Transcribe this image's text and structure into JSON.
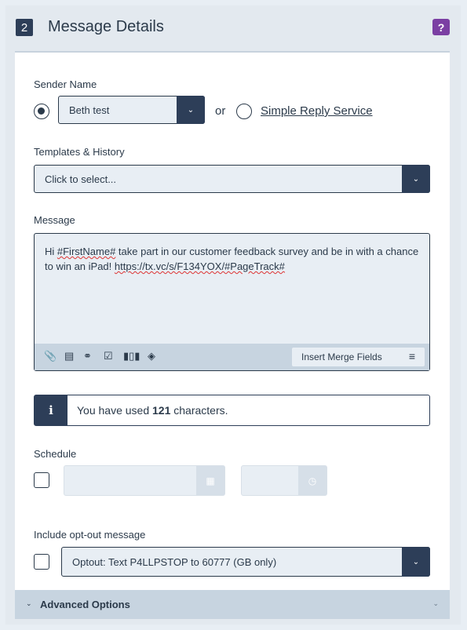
{
  "header": {
    "step": "2",
    "title": "Message Details",
    "help_label": "?"
  },
  "sender": {
    "label": "Sender Name",
    "selected": "Beth test",
    "or_text": "or",
    "alt_option": "Simple Reply Service"
  },
  "templates": {
    "label": "Templates & History",
    "placeholder": "Click to select..."
  },
  "message": {
    "label": "Message",
    "parts": [
      "Hi ",
      "#FirstName#",
      " take part in our customer feedback survey and be in with a chance to win an iPad! ",
      "https://tx.vc/s/F134YOX/#PageTrack#"
    ],
    "toolbar_icons": [
      "attach-icon",
      "document-icon",
      "link-icon",
      "checkbox-icon",
      "barcode-icon",
      "tag-icon"
    ],
    "merge_button": "Insert Merge Fields"
  },
  "info": {
    "prefix": "You have used ",
    "count": "121",
    "suffix": " characters."
  },
  "schedule": {
    "label": "Schedule"
  },
  "optout": {
    "label": "Include opt-out message",
    "selected": "Optout: Text P4LLPSTOP to 60777 (GB only)"
  },
  "advanced": {
    "label": "Advanced Options"
  }
}
